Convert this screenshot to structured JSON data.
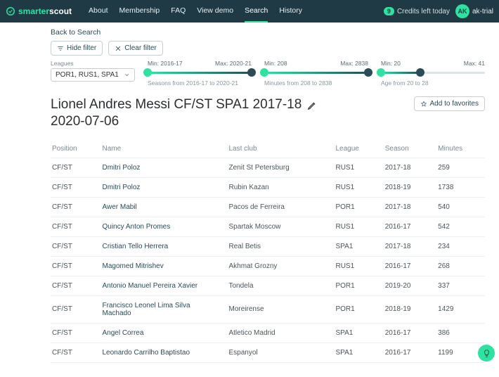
{
  "brand": {
    "name1": "smarter",
    "name2": "scout"
  },
  "nav": {
    "about": "About",
    "membership": "Membership",
    "faq": "FAQ",
    "demo": "View demo",
    "search": "Search",
    "history": "History"
  },
  "credits": {
    "count": "9",
    "label": "Credits left today"
  },
  "user": {
    "initials": "AK",
    "name": "ak-trial"
  },
  "back": "Back to Search",
  "buttons": {
    "hide": "Hide filter",
    "clear": "Clear filter",
    "fav": "Add to favorites"
  },
  "leagues": {
    "label": "Leagues",
    "value": "POR1, RUS1, SPA1"
  },
  "sliders": {
    "season": {
      "minLabel": "Min: 2016-17",
      "maxLabel": "Max: 2020-21",
      "caption": "Seasons from 2016-17 to 2020-21",
      "fillLeft": "0%",
      "fillRight": "0%",
      "hL": "0%",
      "hR": "100%"
    },
    "minutes": {
      "minLabel": "Min: 208",
      "maxLabel": "Max: 2838",
      "caption": "Minutes from 208 to 2838",
      "fillLeft": "0%",
      "fillRight": "0%",
      "hL": "0%",
      "hR": "100%"
    },
    "age": {
      "minLabel": "Min: 20",
      "maxLabel": "Max: 41",
      "caption": "Age from 20 to 28",
      "fillLeft": "0%",
      "fillRight": "62%",
      "hL": "0%",
      "hR": "38%"
    }
  },
  "title": {
    "line1": "Lionel Andres Messi CF/ST SPA1 2017-18",
    "line2": "2020-07-06"
  },
  "columns": {
    "position": "Position",
    "name": "Name",
    "club": "Last club",
    "league": "League",
    "season": "Season",
    "minutes": "Minutes"
  },
  "rows": [
    {
      "pos": "CF/ST",
      "name": "Dmitri Poloz",
      "club": "Zenit St Petersburg",
      "league": "RUS1",
      "season": "2017-18",
      "min": "259"
    },
    {
      "pos": "CF/ST",
      "name": "Dmitri Poloz",
      "club": "Rubin Kazan",
      "league": "RUS1",
      "season": "2018-19",
      "min": "1738"
    },
    {
      "pos": "CF/ST",
      "name": "Awer Mabil",
      "club": "Pacos de Ferreira",
      "league": "POR1",
      "season": "2017-18",
      "min": "540"
    },
    {
      "pos": "CF/ST",
      "name": "Quincy Anton Promes",
      "club": "Spartak Moscow",
      "league": "RUS1",
      "season": "2016-17",
      "min": "542"
    },
    {
      "pos": "CF/ST",
      "name": "Cristian Tello Herrera",
      "club": "Real Betis",
      "league": "SPA1",
      "season": "2017-18",
      "min": "234"
    },
    {
      "pos": "CF/ST",
      "name": "Magomed Mitrishev",
      "club": "Akhmat Grozny",
      "league": "RUS1",
      "season": "2016-17",
      "min": "268"
    },
    {
      "pos": "CF/ST",
      "name": "Antonio Manuel Pereira Xavier",
      "club": "Tondela",
      "league": "POR1",
      "season": "2019-20",
      "min": "337"
    },
    {
      "pos": "CF/ST",
      "name": "Francisco Leonel Lima Silva Machado",
      "club": "Moreirense",
      "league": "POR1",
      "season": "2018-19",
      "min": "1429"
    },
    {
      "pos": "CF/ST",
      "name": "Angel Correa",
      "club": "Atletico Madrid",
      "league": "SPA1",
      "season": "2016-17",
      "min": "386"
    },
    {
      "pos": "CF/ST",
      "name": "Leonardo Carrilho Baptistao",
      "club": "Espanyol",
      "league": "SPA1",
      "season": "2016-17",
      "min": "1199"
    }
  ]
}
